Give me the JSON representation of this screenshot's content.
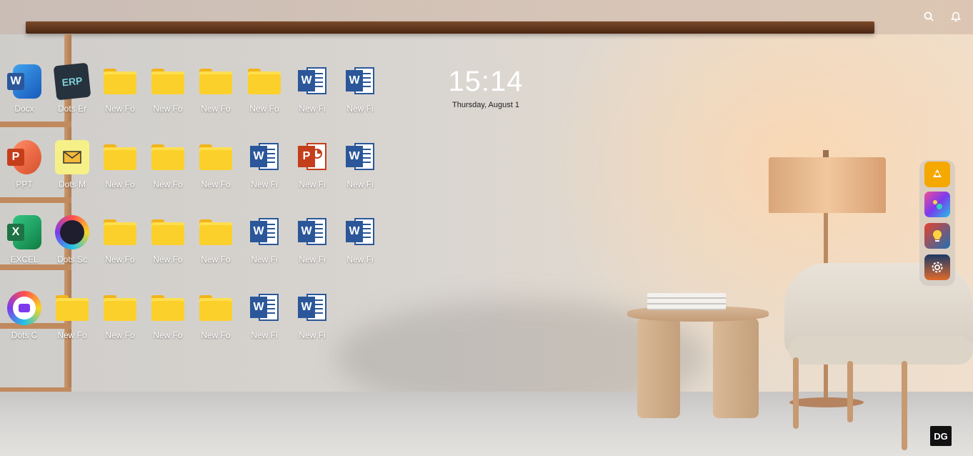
{
  "status_bar": {
    "search_icon": "search-icon",
    "notifications_icon": "bell-icon"
  },
  "clock": {
    "time": "15:14",
    "date": "Thursday, August 1"
  },
  "desktop": {
    "rows": [
      [
        {
          "label": "Docx",
          "icon": "word-app-icon"
        },
        {
          "label": "Dots Er",
          "icon": "erp-icon"
        },
        {
          "label": "New Fo",
          "icon": "folder-icon"
        },
        {
          "label": "New Fo",
          "icon": "folder-icon"
        },
        {
          "label": "New Fo",
          "icon": "folder-icon"
        },
        {
          "label": "New Fo",
          "icon": "folder-icon"
        },
        {
          "label": "New Fi",
          "icon": "word-file-icon"
        },
        {
          "label": "New Fi",
          "icon": "word-file-icon"
        }
      ],
      [
        {
          "label": "PPT",
          "icon": "powerpoint-app-icon"
        },
        {
          "label": "Dots M",
          "icon": "mail-icon"
        },
        {
          "label": "New Fo",
          "icon": "folder-icon"
        },
        {
          "label": "New Fo",
          "icon": "folder-icon"
        },
        {
          "label": "New Fo",
          "icon": "folder-icon"
        },
        {
          "label": "New Fi",
          "icon": "word-file-icon"
        },
        {
          "label": "New Fi",
          "icon": "powerpoint-file-icon"
        },
        {
          "label": "New Fi",
          "icon": "word-file-icon"
        }
      ],
      [
        {
          "label": "EXCEL",
          "icon": "excel-app-icon"
        },
        {
          "label": "Dots Sc",
          "icon": "dots-social-icon"
        },
        {
          "label": "New Fo",
          "icon": "folder-icon"
        },
        {
          "label": "New Fo",
          "icon": "folder-icon"
        },
        {
          "label": "New Fo",
          "icon": "folder-icon"
        },
        {
          "label": "New Fi",
          "icon": "word-file-icon"
        },
        {
          "label": "New Fi",
          "icon": "word-file-icon"
        },
        {
          "label": "New Fi",
          "icon": "word-file-icon"
        }
      ],
      [
        {
          "label": "Dots C",
          "icon": "dots-chat-icon"
        },
        {
          "label": "New Fo",
          "icon": "folder-icon"
        },
        {
          "label": "New Fo",
          "icon": "folder-icon"
        },
        {
          "label": "New Fo",
          "icon": "folder-icon"
        },
        {
          "label": "New Fo",
          "icon": "folder-icon"
        },
        {
          "label": "New Fi",
          "icon": "word-file-icon"
        },
        {
          "label": "New Fi",
          "icon": "word-file-icon"
        }
      ]
    ]
  },
  "dock": {
    "items": [
      {
        "icon": "recycle-bin-icon",
        "color": "#f5a800"
      },
      {
        "icon": "photo-gallery-icon",
        "color": "#d9368b"
      },
      {
        "icon": "lightbulb-icon",
        "color": "#1f6fb5"
      },
      {
        "icon": "settings-gear-icon",
        "color": "#1b3a66"
      }
    ]
  },
  "corner_logo": {
    "text": "DG"
  },
  "colors": {
    "word": "#2b579a",
    "powerpoint": "#c43e1c",
    "excel": "#1f7244",
    "folder": "#fbd02a"
  }
}
